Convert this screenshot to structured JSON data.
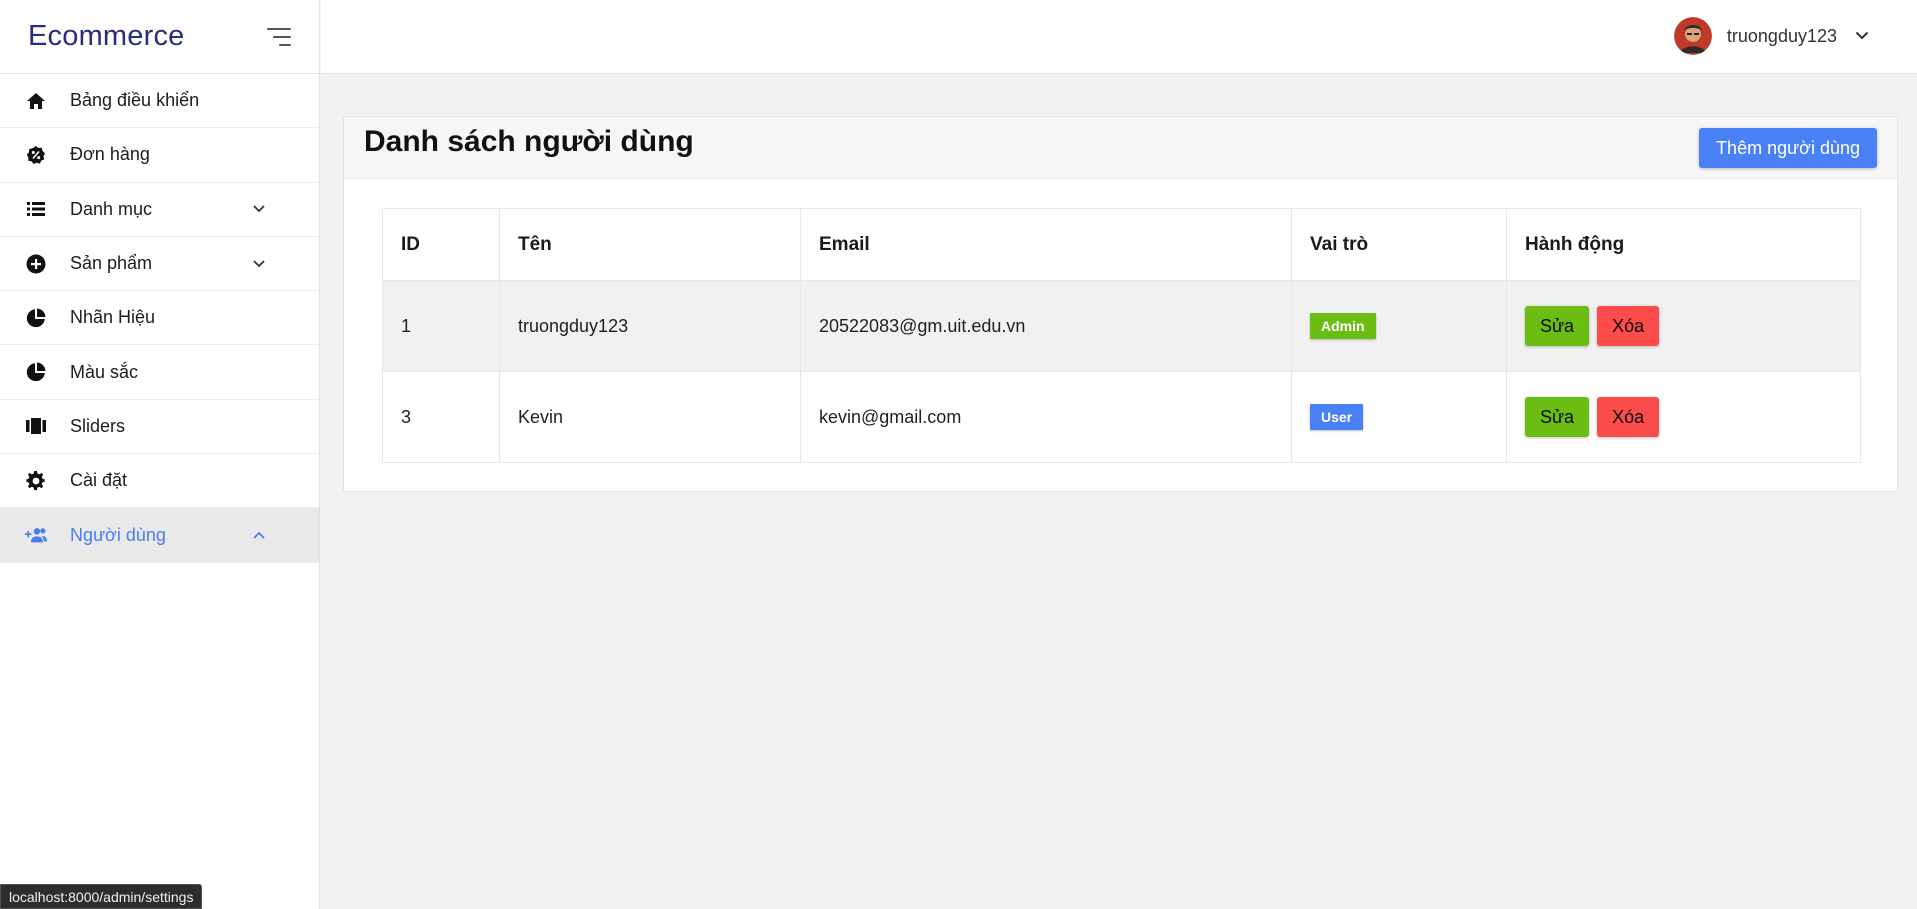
{
  "app": {
    "title": "Ecommerce"
  },
  "sidebar": {
    "items": [
      {
        "label": "Bảng điều khiển",
        "icon": "home-icon",
        "expandable": false
      },
      {
        "label": "Đơn hàng",
        "icon": "percent-badge-icon",
        "expandable": false
      },
      {
        "label": "Danh mục",
        "icon": "list-icon",
        "expandable": true
      },
      {
        "label": "Sản phẩm",
        "icon": "plus-circle-icon",
        "expandable": true
      },
      {
        "label": "Nhãn Hiệu",
        "icon": "pie-chart-icon",
        "expandable": false
      },
      {
        "label": "Màu sắc",
        "icon": "pie-chart-icon",
        "expandable": false
      },
      {
        "label": "Sliders",
        "icon": "carousel-icon",
        "expandable": false
      },
      {
        "label": "Cài đặt",
        "icon": "gear-icon",
        "expandable": false
      },
      {
        "label": "Người dùng",
        "icon": "users-add-icon",
        "expandable": true,
        "active": true
      }
    ]
  },
  "header": {
    "username": "truongduy123"
  },
  "main": {
    "title": "Danh sách người dùng",
    "add_button": "Thêm người dùng",
    "table": {
      "columns": [
        "ID",
        "Tên",
        "Email",
        "Vai trò",
        "Hành động"
      ],
      "rows": [
        {
          "id": "1",
          "name": "truongduy123",
          "email": "20522083@gm.uit.edu.vn",
          "role": "Admin"
        },
        {
          "id": "3",
          "name": "Kevin",
          "email": "kevin@gmail.com",
          "role": "User"
        }
      ],
      "edit_label": "Sửa",
      "delete_label": "Xóa"
    }
  },
  "status_bar": {
    "url": "localhost:8000/admin/settings"
  },
  "colors": {
    "brand": "#25307a",
    "accent": "#4a80f5",
    "success": "#6cbd13",
    "danger": "#fb4b4b"
  }
}
